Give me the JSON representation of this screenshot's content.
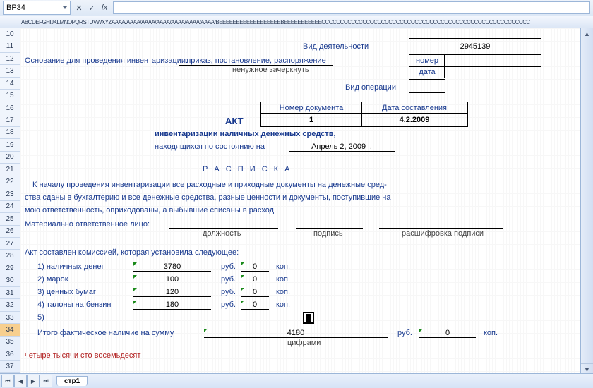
{
  "formula_bar": {
    "cell_ref": "BP34",
    "fx_label": "fx"
  },
  "col_header_text": "ABCDEFGHIJKLMNOPQRSTUVWXYZAAAA/AAAA/AAAA/AAAA/AAAA/AAAA/AAAA/BEEEEEEEEEEEEEEEEEEBEEEEEEEEEEECCCCCCCCCCCCCCCCCCCCCCCCCCCCCCCCCCCCCCCCCCCCCCCCCCCCCCCC",
  "rows": [
    "10",
    "11",
    "12",
    "13",
    "14",
    "15",
    "16",
    "17",
    "18",
    "19",
    "20",
    "21",
    "22",
    "23",
    "24",
    "25",
    "26",
    "27",
    "28",
    "29",
    "30",
    "31",
    "32",
    "33",
    "34",
    "35",
    "36",
    "37"
  ],
  "selected_row": "34",
  "labels": {
    "activity_type": "Вид деятельности",
    "activity_code": "2945139",
    "basis_label": "Основание для проведения инвентаризации:",
    "basis_value": "приказ,  постановление,  распоряжение",
    "basis_note": "ненужное зачеркнуть",
    "number": "номер",
    "date": "дата",
    "oper_type": "Вид операции",
    "doc_num_hdr": "Номер документа",
    "comp_date_hdr": "Дата составления",
    "act": "АКТ",
    "doc_num": "1",
    "comp_date": "4.2.2009",
    "title1": "инвентаризации наличных денежных средств,",
    "title2": "находящихся по состоянию на",
    "status_date": "Апрель 2, 2009 г.",
    "receipt": "Р А С П И С К А",
    "para1": "К началу  проведения  инвентаризации  все  расходные  и  приходные  документы  на   денежные  сред-",
    "para2": "ства сданы  в бухгалтерию и все  денежные  средства,  разные  ценности  и документы, поступившие на",
    "para3": "мою ответственность, оприходованы, а выбывшие списаны в расход.",
    "responsible": "Материально ответственное лицо:",
    "position": "должность",
    "signature": "подпись",
    "signature_decode": "расшифровка подписи",
    "commission": "Акт составлен комиссией, которая установила следующее:",
    "items": [
      {
        "n": "1) наличных денег",
        "v": "3780"
      },
      {
        "n": "2) марок",
        "v": "100"
      },
      {
        "n": "3) ценных бумаг",
        "v": "120"
      },
      {
        "n": "4) талоны на бензин",
        "v": "180"
      },
      {
        "n": "5)",
        "v": ""
      }
    ],
    "rub": "руб.",
    "kop": "коп.",
    "zero": "0",
    "total_label": "Итого фактическое наличие на сумму",
    "total": "4180",
    "digits": "цифрами",
    "words": "четыре тысячи сто восемьдесят"
  },
  "sheet_tab": "стр1"
}
